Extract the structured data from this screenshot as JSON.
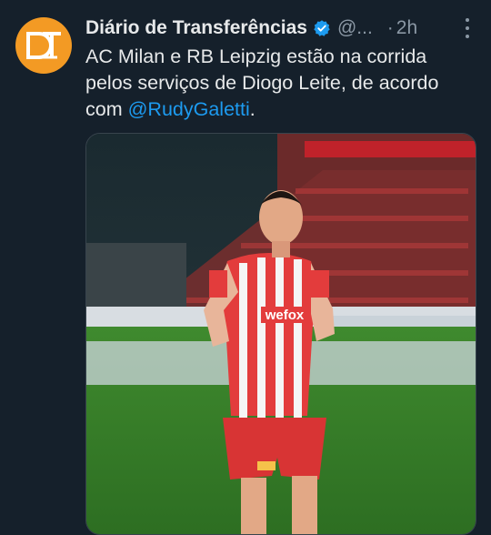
{
  "account": {
    "name": "Diário de Transferências",
    "handle": "@...",
    "separator": "·",
    "time": "2h",
    "avatar_initials": "DT",
    "avatar_color": "#f39a24",
    "verified_color": "#1d9bf0"
  },
  "tweet": {
    "text_before": "AC Milan e RB Leipzig estão na corrida pelos serviços de Diogo Leite, de acordo com ",
    "mention": "@RudyGaletti",
    "text_after": "."
  },
  "media": {
    "shirt_sponsor": "wefox"
  },
  "icons": {
    "verified": "verified-badge-icon",
    "more": "more-options-icon"
  }
}
